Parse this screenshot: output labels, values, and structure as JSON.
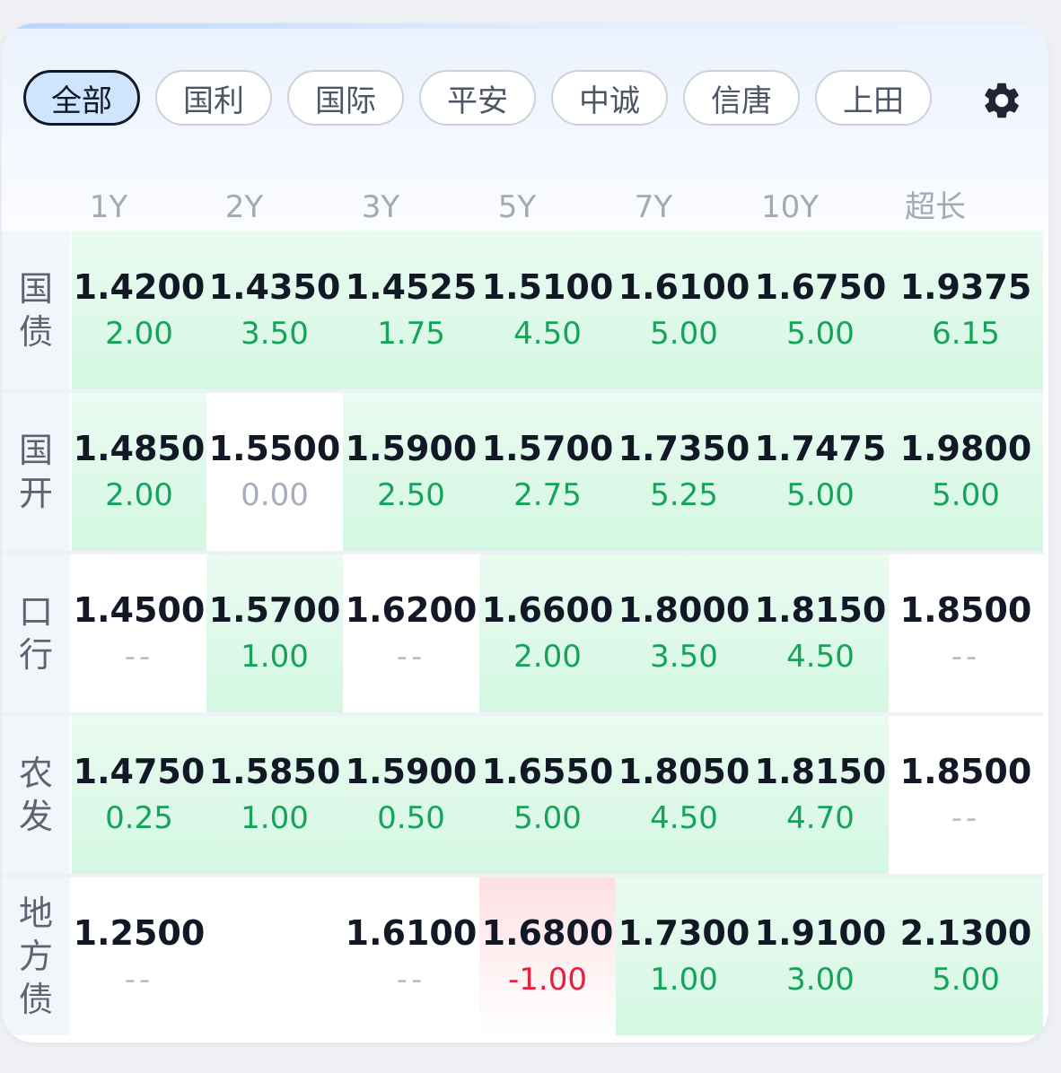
{
  "tabs": [
    {
      "label": "全部",
      "active": true
    },
    {
      "label": "国利",
      "active": false
    },
    {
      "label": "国际",
      "active": false
    },
    {
      "label": "平安",
      "active": false
    },
    {
      "label": "中诚",
      "active": false
    },
    {
      "label": "信唐",
      "active": false
    },
    {
      "label": "上田",
      "active": false
    }
  ],
  "settings_icon": "gear-icon",
  "columns": [
    "1Y",
    "2Y",
    "3Y",
    "5Y",
    "7Y",
    "10Y",
    "超长"
  ],
  "rows": [
    {
      "label": "国\n债",
      "cells": [
        {
          "value": "1.4200",
          "change": "2.00",
          "state": "up"
        },
        {
          "value": "1.4350",
          "change": "3.50",
          "state": "up"
        },
        {
          "value": "1.4525",
          "change": "1.75",
          "state": "up"
        },
        {
          "value": "1.5100",
          "change": "4.50",
          "state": "up"
        },
        {
          "value": "1.6100",
          "change": "5.00",
          "state": "up"
        },
        {
          "value": "1.6750",
          "change": "5.00",
          "state": "up"
        },
        {
          "value": "1.9375",
          "change": "6.15",
          "state": "up"
        }
      ]
    },
    {
      "label": "国\n开",
      "cells": [
        {
          "value": "1.4850",
          "change": "2.00",
          "state": "up"
        },
        {
          "value": "1.5500",
          "change": "0.00",
          "state": "zero"
        },
        {
          "value": "1.5900",
          "change": "2.50",
          "state": "up"
        },
        {
          "value": "1.5700",
          "change": "2.75",
          "state": "up"
        },
        {
          "value": "1.7350",
          "change": "5.25",
          "state": "up"
        },
        {
          "value": "1.7475",
          "change": "5.00",
          "state": "up"
        },
        {
          "value": "1.9800",
          "change": "5.00",
          "state": "up"
        }
      ]
    },
    {
      "label": "口\n行",
      "cells": [
        {
          "value": "1.4500",
          "change": "--",
          "state": "none"
        },
        {
          "value": "1.5700",
          "change": "1.00",
          "state": "up"
        },
        {
          "value": "1.6200",
          "change": "--",
          "state": "none"
        },
        {
          "value": "1.6600",
          "change": "2.00",
          "state": "up"
        },
        {
          "value": "1.8000",
          "change": "3.50",
          "state": "up"
        },
        {
          "value": "1.8150",
          "change": "4.50",
          "state": "up"
        },
        {
          "value": "1.8500",
          "change": "--",
          "state": "none"
        }
      ]
    },
    {
      "label": "农\n发",
      "cells": [
        {
          "value": "1.4750",
          "change": "0.25",
          "state": "up"
        },
        {
          "value": "1.5850",
          "change": "1.00",
          "state": "up"
        },
        {
          "value": "1.5900",
          "change": "0.50",
          "state": "up"
        },
        {
          "value": "1.6550",
          "change": "5.00",
          "state": "up"
        },
        {
          "value": "1.8050",
          "change": "4.50",
          "state": "up"
        },
        {
          "value": "1.8150",
          "change": "4.70",
          "state": "up"
        },
        {
          "value": "1.8500",
          "change": "--",
          "state": "none"
        }
      ]
    },
    {
      "label": "地\n方\n债",
      "cells": [
        {
          "value": "1.2500",
          "change": "--",
          "state": "none"
        },
        {
          "value": "",
          "change": "",
          "state": "empty"
        },
        {
          "value": "1.6100",
          "change": "--",
          "state": "none"
        },
        {
          "value": "1.6800",
          "change": "-1.00",
          "state": "down"
        },
        {
          "value": "1.7300",
          "change": "1.00",
          "state": "up"
        },
        {
          "value": "1.9100",
          "change": "3.00",
          "state": "up"
        },
        {
          "value": "2.1300",
          "change": "5.00",
          "state": "up"
        }
      ]
    }
  ],
  "colors": {
    "up": "#17a35a",
    "down": "#e6203f",
    "neutral": "#a7aeba",
    "accent": "#cfe5fe"
  }
}
